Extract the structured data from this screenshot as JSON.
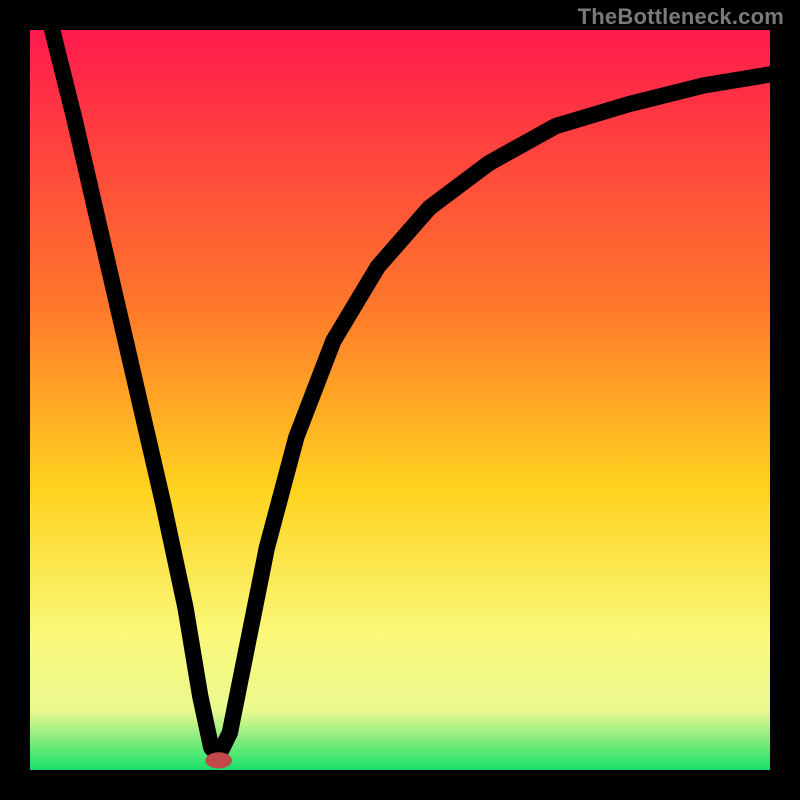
{
  "watermark": "TheBottleneck.com",
  "chart_data": {
    "type": "line",
    "title": "",
    "xlabel": "",
    "ylabel": "",
    "xlim": [
      0,
      100
    ],
    "ylim": [
      0,
      100
    ],
    "grid": false,
    "legend": false,
    "gradient_stops": [
      {
        "offset": 0,
        "color": "#ff1a4d"
      },
      {
        "offset": 38,
        "color": "#ff7a2a"
      },
      {
        "offset": 62,
        "color": "#ffd21f"
      },
      {
        "offset": 82,
        "color": "#f9f97a"
      },
      {
        "offset": 92,
        "color": "#eaf98f"
      },
      {
        "offset": 100,
        "color": "#18e06a"
      }
    ],
    "series": [
      {
        "name": "bottleneck-curve",
        "x": [
          3,
          6,
          9,
          12,
          15,
          18,
          21,
          23,
          24.5,
          25.5,
          27,
          29,
          32,
          36,
          41,
          47,
          54,
          62,
          71,
          81,
          91,
          100
        ],
        "y": [
          100,
          88,
          75,
          62,
          49,
          36,
          22,
          10,
          3,
          2,
          5,
          15,
          30,
          45,
          58,
          68,
          76,
          82,
          87,
          90,
          92.5,
          94
        ]
      }
    ],
    "marker": {
      "x": 25.5,
      "y": 1.3,
      "rx": 1.8,
      "ry": 1.1,
      "color": "#c04a4a"
    }
  }
}
